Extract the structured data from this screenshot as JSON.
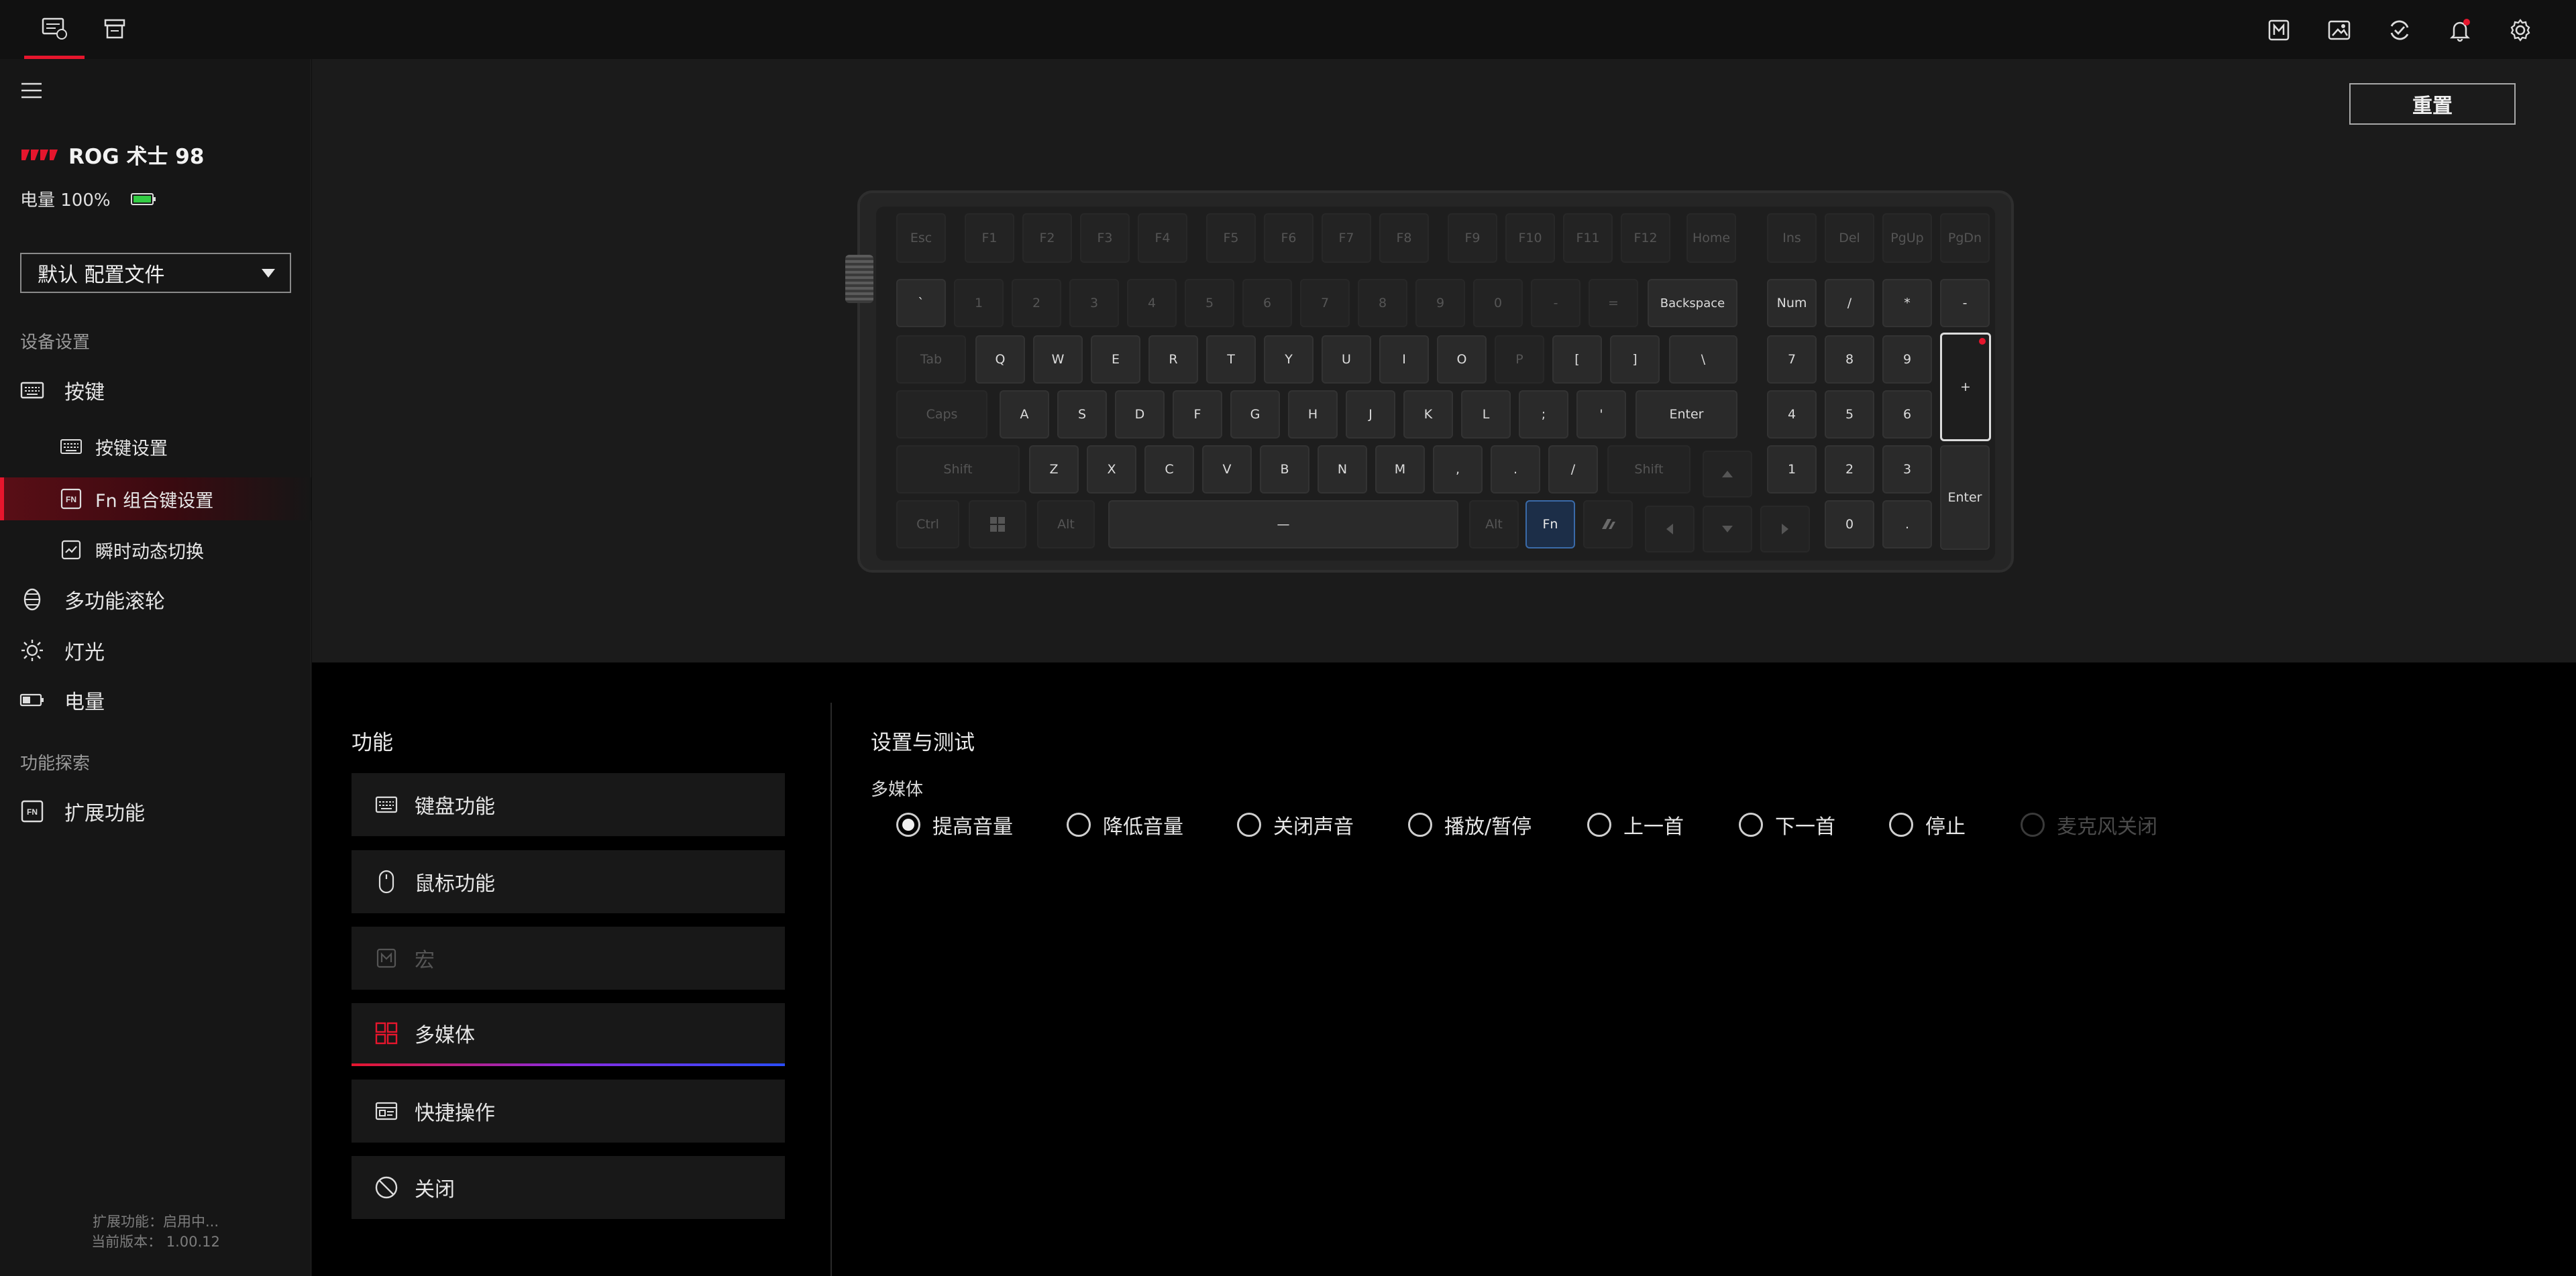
{
  "topbar": {
    "tabs": [
      {
        "icon": "device-keyboard-icon",
        "active": true
      },
      {
        "icon": "device-dock-icon",
        "active": false
      }
    ],
    "right_icons": [
      "macro-icon",
      "picture-icon",
      "sync-icon",
      "bell-icon",
      "gear-icon"
    ],
    "accent": "#e6162d"
  },
  "sidebar": {
    "device_name": "ROG 术士 98",
    "battery_label": "电量 100%",
    "battery_color": "#33cc44",
    "profile": "默认 配置文件",
    "section_device": "设备设置",
    "nav_keys": "按键",
    "sub_key_settings": "按键设置",
    "sub_fn_settings": "Fn 组合键设置",
    "sub_instant": "瞬时动态切换",
    "nav_wheel": "多功能滚轮",
    "nav_light": "灯光",
    "nav_power": "电量",
    "section_explore": "功能探索",
    "nav_ext": "扩展功能",
    "footer_line1": "扩展功能：启用中...",
    "footer_line2": "当前版本：  1.00.12"
  },
  "reset_label": "重置",
  "keyboard": {
    "row_f": [
      "Esc",
      "F1",
      "F2",
      "F3",
      "F4",
      "F5",
      "F6",
      "F7",
      "F8",
      "F9",
      "F10",
      "F11",
      "F12",
      "Home",
      "Ins",
      "Del",
      "PgUp",
      "PgDn"
    ],
    "row_num": [
      "`",
      "1",
      "2",
      "3",
      "4",
      "5",
      "6",
      "7",
      "8",
      "9",
      "0",
      "-",
      "=",
      "Backspace",
      "Num",
      "/",
      "*",
      "-"
    ],
    "row_q": [
      "Tab",
      "Q",
      "W",
      "E",
      "R",
      "T",
      "Y",
      "U",
      "I",
      "O",
      "P",
      "[",
      "]",
      "\\",
      "7",
      "8",
      "9",
      "+"
    ],
    "row_a": [
      "Caps",
      "A",
      "S",
      "D",
      "F",
      "G",
      "H",
      "J",
      "K",
      "L",
      ";",
      "'",
      "Enter",
      "4",
      "5",
      "6"
    ],
    "row_z": [
      "Shift",
      "Z",
      "X",
      "C",
      "V",
      "B",
      "N",
      "M",
      ",",
      ".",
      "/",
      "Shift",
      "1",
      "2",
      "3",
      "Enter"
    ],
    "row_ctrl": [
      "Ctrl",
      "Win",
      "Alt",
      "—",
      "Alt",
      "Fn",
      "Copilot",
      "0",
      "."
    ]
  },
  "functions": {
    "title": "功能",
    "items": [
      "键盘功能",
      "鼠标功能",
      "宏",
      "多媒体",
      "快捷操作",
      "关闭"
    ],
    "selected": "多媒体",
    "disabled": [
      "宏"
    ]
  },
  "settings": {
    "title": "设置与测试",
    "category": "多媒体",
    "options": [
      "提高音量",
      "降低音量",
      "关闭声音",
      "播放/暂停",
      "上一首",
      "下一首",
      "停止",
      "麦克风关闭"
    ],
    "selected": "提高音量",
    "disabled": [
      "麦克风关闭"
    ]
  }
}
